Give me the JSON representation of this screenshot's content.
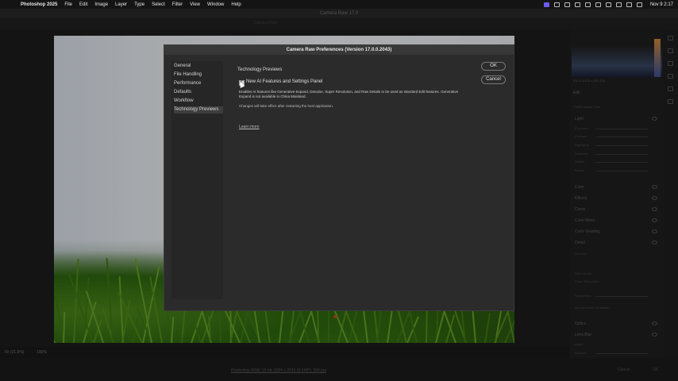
{
  "menubar": {
    "app": "Photoshop 2025",
    "menus": [
      "File",
      "Edit",
      "Image",
      "Layer",
      "Type",
      "Select",
      "Filter",
      "View",
      "Window",
      "Help"
    ],
    "clock": "Nov 9  2:17"
  },
  "window": {
    "title": "Camera Raw 17.0",
    "filename": "Camera Raw"
  },
  "canvas": {
    "zoom_left": "Fit (31.8%)",
    "zoom_right": "100%"
  },
  "footer": {
    "file_info": "Photoshop RGB; 16 bit; 3024 x 2016 (6.1MP); 300 ppi",
    "cancel_label": "Cancel",
    "ok_label": "OK"
  },
  "right_panel": {
    "exif": "f/10.0  1/125 s  ISO 100",
    "edit_label": "Edit",
    "profile_label": "Profile  Adobe Color",
    "sections": [
      "Light",
      "Color",
      "Effects",
      "Curve",
      "Color Mixer",
      "Color Grading",
      "Detail",
      "Optics",
      "Lens Blur"
    ],
    "light_sliders": [
      "Exposure",
      "Contrast",
      "Highlights",
      "Shadows",
      "Whites",
      "Blacks"
    ],
    "detail_items": [
      "Denoise",
      "Raw Details",
      "Super Resolution",
      "Sharpening",
      "Manual Noise Reduction"
    ],
    "lens_blur_items": [
      "Apply",
      "Amount"
    ]
  },
  "dialog": {
    "title": "Camera Raw Preferences  (Version 17.0.0.2043)",
    "nav": [
      "General",
      "File Handling",
      "Performance",
      "Defaults",
      "Workflow",
      "Technology Previews"
    ],
    "active_nav": "Technology Previews",
    "heading": "Technology Previews",
    "feature_label": "New AI Features and Settings Panel",
    "feature_checked": true,
    "feature_desc": "Enables AI features like Generative Expand, Denoise, Super Resolution, and Raw Details to be used as standard Edit features. Generative Expand is not available in China Mainland.",
    "restart_note": "Changes will take effect after restarting the host application.",
    "learn_more": "Learn more",
    "ok_label": "OK",
    "cancel_label": "Cancel"
  }
}
